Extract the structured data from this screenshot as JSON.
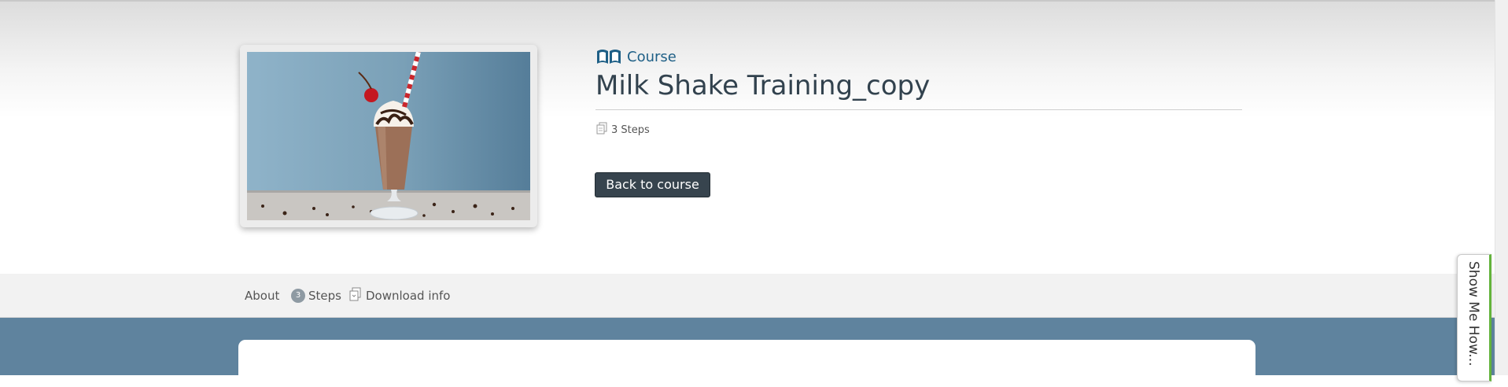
{
  "header": {
    "course_kind_label": "Course",
    "course_title": "Milk Shake Training_copy",
    "steps_meta": "3 Steps",
    "back_button_label": "Back to course",
    "thumbnail_alt": "Milk shake"
  },
  "tabs": [
    {
      "label": "About"
    },
    {
      "badge": "3",
      "label": "Steps"
    },
    {
      "label": "Download info"
    }
  ],
  "side_widget": {
    "label": "Show Me How..."
  },
  "colors": {
    "accent": "#1e5f86",
    "button": "#37444e",
    "content_background": "#5f839e",
    "side_widget_border": "#63b33b"
  },
  "icons": [
    "course-book-icon",
    "steps-pages-icon",
    "download-document-icon"
  ]
}
